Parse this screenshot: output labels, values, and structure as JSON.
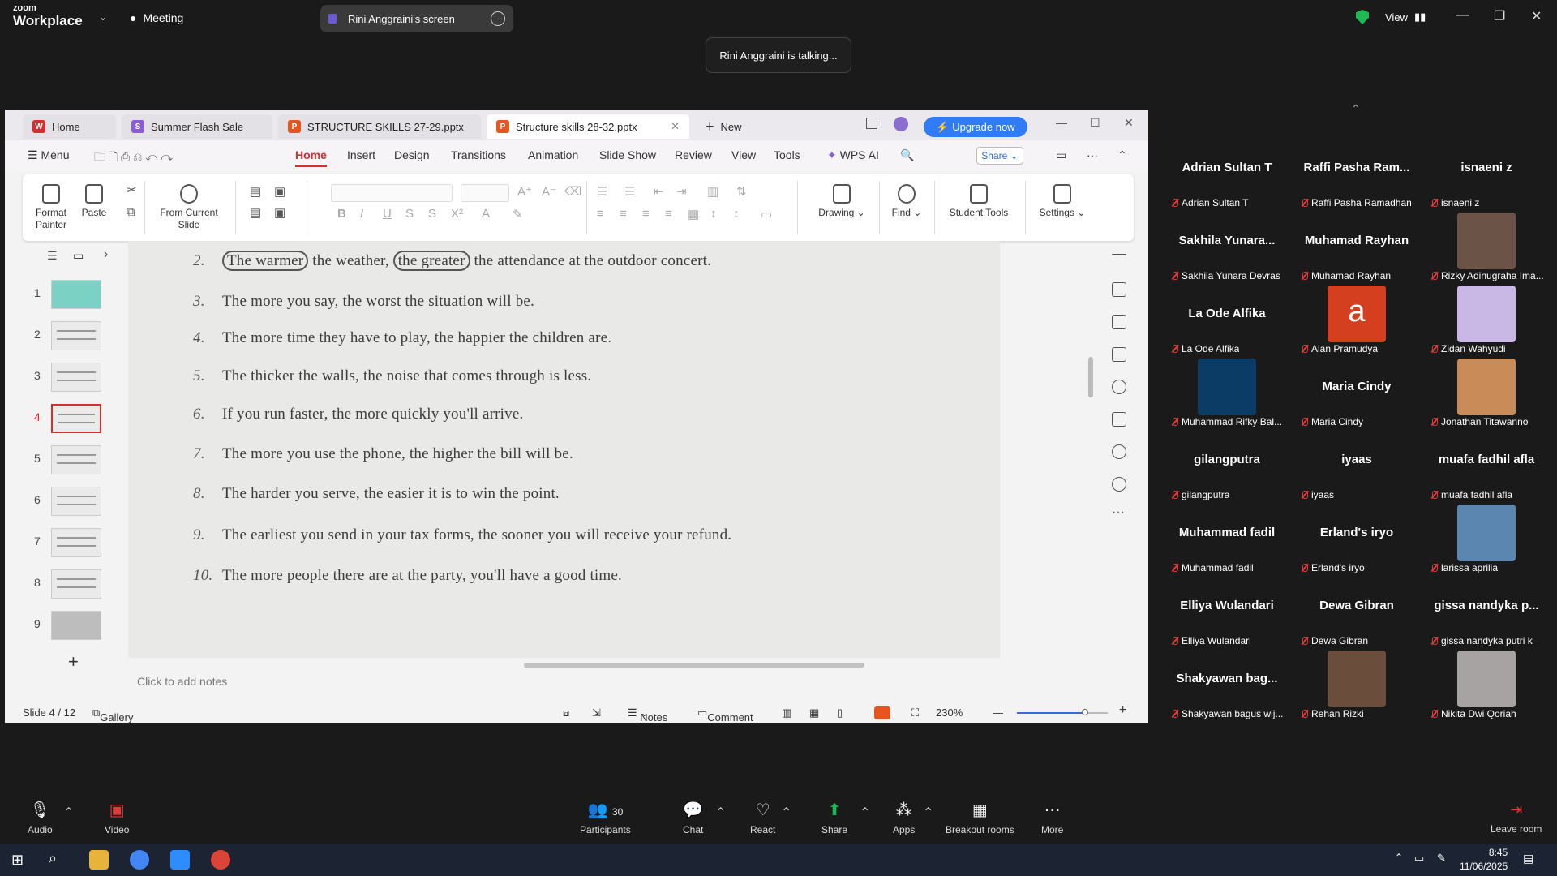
{
  "zoom": {
    "brand_top": "zoom",
    "brand_bottom": "Workplace",
    "meeting_label": "Meeting",
    "screen_label": "Rini Anggraini's screen",
    "view_label": "View",
    "toast": "Rini Anggraini is talking...",
    "toolbar": {
      "audio": "Audio",
      "video": "Video",
      "participants": "Participants",
      "participants_count": "30",
      "chat": "Chat",
      "react": "React",
      "share": "Share",
      "apps": "Apps",
      "breakout": "Breakout rooms",
      "more": "More",
      "leave": "Leave room"
    }
  },
  "wps": {
    "tabs": [
      {
        "label": "Home"
      },
      {
        "label": "Summer Flash Sale"
      },
      {
        "label": "STRUCTURE SKILLS 27-29.pptx"
      },
      {
        "label": "Structure skills 28-32.pptx"
      },
      {
        "label": "New"
      }
    ],
    "upgrade": "Upgrade now",
    "menu": [
      "Menu",
      "Home",
      "Insert",
      "Design",
      "Transitions",
      "Animation",
      "Slide Show",
      "Review",
      "View",
      "Tools",
      "WPS AI"
    ],
    "share": "Share",
    "ribbon": {
      "format_painter": "Format Painter",
      "paste": "Paste",
      "from_current_slide": "From Current Slide",
      "drawing": "Drawing",
      "find": "Find",
      "student_tools": "Student Tools",
      "settings": "Settings"
    },
    "thumb_numbers": [
      "1",
      "2",
      "3",
      "4",
      "5",
      "6",
      "7",
      "8",
      "9"
    ],
    "active_slide": 4,
    "slide_lines": [
      {
        "num": "2.",
        "pre": "",
        "c1": "The warmer",
        "mid": " the weather, ",
        "c2": "the greater",
        "post": " the attendance at the outdoor concert."
      },
      {
        "num": "3.",
        "text": "The more you say, the worst the situation will be."
      },
      {
        "num": "4.",
        "text": "The more time they have to play, the happier the children are."
      },
      {
        "num": "5.",
        "text": "The thicker the walls, the noise that comes through is less."
      },
      {
        "num": "6.",
        "text": "If you run faster, the more quickly you'll arrive."
      },
      {
        "num": "7.",
        "text": "The more you use the phone, the higher the bill will be."
      },
      {
        "num": "8.",
        "text": "The harder you serve, the easier it is to win the point."
      },
      {
        "num": "9.",
        "text": "The earliest you send in your tax forms, the sooner you will receive your refund."
      },
      {
        "num": "10.",
        "text": "The more people there are at the party, you'll have a good time."
      }
    ],
    "notes_placeholder": "Click to add notes",
    "status": {
      "slide": "Slide 4 / 12",
      "gallery": "Gallery",
      "notes": "Notes",
      "comment": "Comment",
      "zoom": "230%"
    }
  },
  "participants": [
    {
      "name": "Adrian Sultan T",
      "label": "Adrian Sultan T"
    },
    {
      "name": "Raffi Pasha Ram...",
      "label": "Raffi Pasha Ramadhan"
    },
    {
      "name": "isnaeni z",
      "label": "isnaeni z"
    },
    {
      "name": "Sakhila Yunara...",
      "label": "Sakhila Yunara Devras"
    },
    {
      "name": "Muhamad Rayhan",
      "label": "Muhamad Rayhan"
    },
    {
      "name": "",
      "label": "Rizky Adinugraha Ima..."
    },
    {
      "name": "La Ode Alfika",
      "label": "La Ode Alfika"
    },
    {
      "name": "a",
      "label": "Alan Pramudya"
    },
    {
      "name": "",
      "label": "Zidan Wahyudi"
    },
    {
      "name": "",
      "label": "Muhammad Rifky Bal..."
    },
    {
      "name": "Maria Cindy",
      "label": "Maria Cindy"
    },
    {
      "name": "",
      "label": "Jonathan Titawanno"
    },
    {
      "name": "gilangputra",
      "label": "gilangputra"
    },
    {
      "name": "iyaas",
      "label": "iyaas"
    },
    {
      "name": "muafa fadhil afla",
      "label": "muafa fadhil afla"
    },
    {
      "name": "Muhammad fadil",
      "label": "Muhammad fadil"
    },
    {
      "name": "Erland's iryo",
      "label": "Erland's iryo"
    },
    {
      "name": "",
      "label": "larissa aprilia"
    },
    {
      "name": "Elliya Wulandari",
      "label": "Elliya Wulandari"
    },
    {
      "name": "Dewa Gibran",
      "label": "Dewa Gibran"
    },
    {
      "name": "gissa nandyka p...",
      "label": "gissa nandyka putri k"
    },
    {
      "name": "Shakyawan bag...",
      "label": "Shakyawan bagus wij..."
    },
    {
      "name": "",
      "label": "Rehan Rizki"
    },
    {
      "name": "",
      "label": "Nikita Dwi Qoriah"
    }
  ],
  "taskbar": {
    "time": "8:45",
    "date": "11/06/2025"
  },
  "colors": {
    "zoom_bg": "#1a1a1a",
    "wps_accent": "#d32f2f",
    "upgrade": "#2f7cf6",
    "mic_muted": "#e03b3b"
  }
}
